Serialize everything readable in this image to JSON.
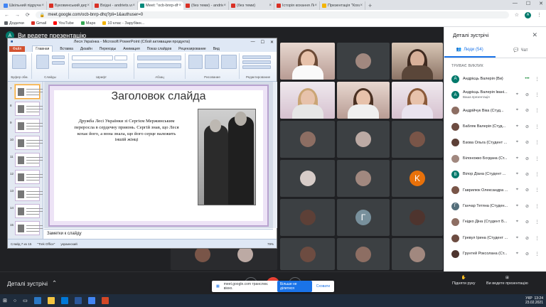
{
  "browser": {
    "tabs": [
      {
        "label": "Шкільний підручник 7 клас укр",
        "color": "#4285f4"
      },
      {
        "label": "Буковинський державний мед",
        "color": "#d93025"
      },
      {
        "label": "Вхідні - andriets.valeriia@bsm",
        "color": "#d93025"
      },
      {
        "label": "Meet: \"ocb-bnrp-dhq\"",
        "color": "#00897b",
        "active": true
      },
      {
        "label": "(без теми) - andriets.valeriia@bs",
        "color": "#d93025"
      },
      {
        "label": "(без теми)",
        "color": "#d93025"
      },
      {
        "label": "Історія кохання Лесі Українки і",
        "color": "#d93025"
      },
      {
        "label": "Презентація \"Кохання в житті",
        "color": "#f4b400"
      }
    ],
    "url": "meet.google.com/ocb-bnrp-dhq?pli=1&authuser=0",
    "bookmarks": [
      {
        "label": "Додатки",
        "color": "#5f6368"
      },
      {
        "label": "Gmail",
        "color": "#d93025"
      },
      {
        "label": "YouTube",
        "color": "#ff0000"
      },
      {
        "label": "Марs",
        "color": "#34a853"
      },
      {
        "label": "10 клас - Зарубіжн...",
        "color": "#f4b400"
      }
    ]
  },
  "meet": {
    "presenter_banner": "Ви ведете презентацію",
    "presenter_initial": "A",
    "meeting_details_label": "Деталі зустрічі",
    "share_notice": {
      "text": "meet.google.com транслює вікно.",
      "stop_label": "Більше не ділитися",
      "hide_label": "Сховати"
    },
    "raise_hand_label": "Підняти руку",
    "present_label": "Ви ведете презентацію",
    "tile_letters": [
      "K",
      "Г"
    ]
  },
  "ppt": {
    "window_title": "Леся Українка - Microsoft PowerPoint (Сбой активации продукта)",
    "tabs": [
      "Файл",
      "Главная",
      "Вставка",
      "Дизайн",
      "Переходы",
      "Анимация",
      "Показ слайдов",
      "Рецензирование",
      "Вид"
    ],
    "groups": [
      "Буфер обм.",
      "Слайды",
      "Шрифт",
      "Абзац",
      "Рисование",
      "Редактирование"
    ],
    "slide_title": "Заголовок слайда",
    "slide_text": "Дружба Лесі Українки зі Сергієм Мержинським переросла в сердечну приязнь. Сергій знав, що Леся кохає його, а вона знала, що його серце належить іншій жінці",
    "notes_placeholder": "Заметки к слайду",
    "status": {
      "slide": "Слайд 7 из 15",
      "theme": "\"Trek Office\"",
      "lang": "украинский",
      "zoom": "79%"
    },
    "thumb_numbers": [
      "7",
      "8",
      "9",
      "10",
      "11",
      "12",
      "13",
      "14",
      "15"
    ]
  },
  "panel": {
    "title": "Деталі зустрічі",
    "tab_people": "Люди (54)",
    "tab_chat": "Чат",
    "section": "ТРИВАЄ ВИКЛИК",
    "people": [
      {
        "name": "Андрієць Валерія (Ви)",
        "initial": "A",
        "color": "#00796b",
        "sub": ""
      },
      {
        "name": "Андрієць Валерія Івані...",
        "initial": "A",
        "color": "#00796b",
        "sub": "Ваша презентація"
      },
      {
        "name": "Андрійчук Віка (Студ...",
        "initial": "",
        "color": "#8d6e63",
        "sub": ""
      },
      {
        "name": "Бабляк Валерія (Студ...",
        "initial": "",
        "color": "#6d4c41",
        "sub": ""
      },
      {
        "name": "Бзова Ольга (Студент ...",
        "initial": "",
        "color": "#5d4037",
        "sub": ""
      },
      {
        "name": "Білоножко Богдана (Ст...",
        "initial": "",
        "color": "#a1887f",
        "sub": ""
      },
      {
        "name": "Вілор Діана (Студент ...",
        "initial": "В",
        "color": "#00796b",
        "sub": ""
      },
      {
        "name": "Гаврилюк Олександра ...",
        "initial": "",
        "color": "#795548",
        "sub": ""
      },
      {
        "name": "Ганчар Тетяна (Студен...",
        "initial": "Г",
        "color": "#546e7a",
        "sub": ""
      },
      {
        "name": "Гнідко Діна (Студент Б...",
        "initial": "",
        "color": "#8d6e63",
        "sub": ""
      },
      {
        "name": "Гревул Ірина (Студент ...",
        "initial": "",
        "color": "#6d4c41",
        "sub": ""
      },
      {
        "name": "Грунтей Роксолана (Ст...",
        "initial": "",
        "color": "#4e342e",
        "sub": ""
      }
    ]
  },
  "taskbar": {
    "time": "13:24",
    "date": "23.02.2021",
    "lang": "УКР"
  }
}
